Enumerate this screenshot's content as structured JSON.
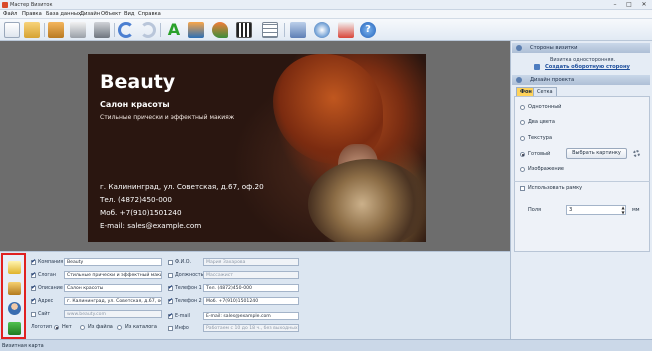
{
  "window": {
    "title": "Мастер Визиток",
    "controls": {
      "min": "–",
      "max": "□",
      "close": "✕"
    }
  },
  "menu": [
    "Файл",
    "Правка",
    "База данных",
    "Дизайн",
    "Объект",
    "Вид",
    "Справка"
  ],
  "toolbar": {
    "icons": [
      "new-file-icon",
      "open-file-icon",
      "save-icon",
      "print-icon",
      "undo-icon",
      "redo-icon",
      "text-icon",
      "image-icon",
      "map-pin-icon",
      "qr-code-icon",
      "table-icon",
      "zoom-icon",
      "settings-icon",
      "help-icon"
    ]
  },
  "card": {
    "title": "Beauty",
    "slogan": "Салон красоты",
    "description": "Стильные прически и эффектный макияж",
    "address": "г. Калининград, ул. Советская, д.67, оф.20",
    "phone1": "Тел. (4872)450-000",
    "phone2": "Моб. +7(910)1501240",
    "email": "E-mail: sales@example.com"
  },
  "sidebar": {
    "sides_header": "Стороны визитки",
    "sides_note": "Визитка односторонняя.",
    "create_back_link": "Создать оборотную сторону",
    "design_header": "Дизайн проекта",
    "tabs": [
      "Фон",
      "Сетка"
    ],
    "background_options": [
      {
        "label": "Однотонный",
        "selected": false
      },
      {
        "label": "Два цвета",
        "selected": false
      },
      {
        "label": "Текстура",
        "selected": false
      },
      {
        "label": "Готовый",
        "selected": true
      },
      {
        "label": "Изображение",
        "selected": false
      }
    ],
    "choose_picture_button": "Выбрать картинку",
    "use_frame_label": "Использовать рамку",
    "margins_label": "Поля",
    "margins_value": "3",
    "margins_unit": "мм"
  },
  "form": {
    "rows": [
      {
        "label": "Компания",
        "value": "Beauty",
        "checked": true
      },
      {
        "label": "Слоган",
        "value": "Стильные прически и эффектный макияж",
        "checked": true
      },
      {
        "label": "Описание",
        "value": "Салон красоты",
        "checked": true
      },
      {
        "label": "Адрес",
        "value": "г. Калининград, ул. Советская, д.67, оф.20",
        "checked": true
      },
      {
        "label": "Сайт",
        "value": "www.beauty.com",
        "checked": false
      }
    ],
    "rows_right": [
      {
        "label": "Ф.И.О.",
        "value": "Мария Захарова",
        "checked": false
      },
      {
        "label": "Должность",
        "value": "Массажист",
        "checked": false
      },
      {
        "label": "Телефон 1",
        "value": "Тел. (4872)450-000",
        "checked": true
      },
      {
        "label": "Телефон 2",
        "value": "Моб. +7(910)1501240",
        "checked": true
      },
      {
        "label": "E-mail",
        "value": "E-mail: sales@example.com",
        "checked": true
      },
      {
        "label": "Инфо",
        "value": "Работаем с 10 до 18 ч., без выходных",
        "checked": false
      }
    ],
    "logo_label": "Логотип",
    "logo_options": [
      "Нет",
      "Из файла",
      "Из каталога"
    ]
  },
  "status": "Визитная карта"
}
